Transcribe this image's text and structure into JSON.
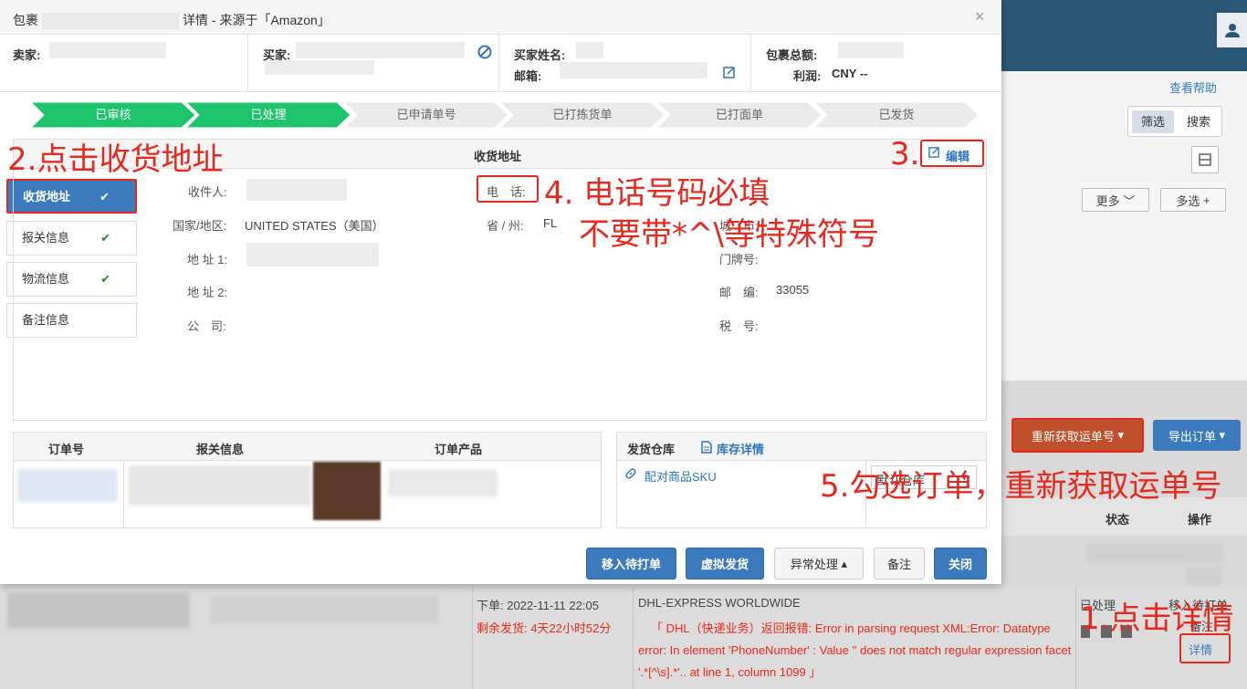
{
  "modal": {
    "title_prefix": "包裹",
    "title_suffix": "详情 - 来源于「Amazon」",
    "close": "×",
    "info": {
      "seller_label": "卖家:",
      "buyer_label": "买家:",
      "buyer_name_label": "买家姓名:",
      "email_label": "邮箱:",
      "total_label": "包裹总额:",
      "profit_label": "利润:",
      "profit_value": "CNY --"
    },
    "steps": [
      "已审核",
      "已处理",
      "已申请单号",
      "已打拣货单",
      "已打面单",
      "已发货"
    ],
    "nav": [
      {
        "label": "收货地址",
        "done": true,
        "active": true
      },
      {
        "label": "报关信息",
        "done": true,
        "active": false
      },
      {
        "label": "物流信息",
        "done": true,
        "active": false
      },
      {
        "label": "备注信息",
        "done": false,
        "active": false
      }
    ],
    "address": {
      "title": "收货地址",
      "edit": "编辑",
      "recipient_label": "收件人:",
      "country_label": "国家/地区:",
      "country_value": "UNITED STATES（美国）",
      "addr1_label": "地 址 1:",
      "addr2_label": "地 址 2:",
      "company_label": "公　司:",
      "phone_label": "电　话:",
      "state_label": "省 / 州:",
      "state_value": "FL",
      "city_label": "城　市:",
      "door_label": "门牌号:",
      "zip_label": "邮　编:",
      "zip_value": "33055",
      "tax_label": "税　号:"
    },
    "orders": {
      "col_order": "订单号",
      "col_customs": "报关信息",
      "col_product": "订单产品"
    },
    "warehouse": {
      "title": "发货仓库",
      "stock_link": "库存详情",
      "match_sku": "配对商品SKU",
      "default_wh": "默认仓库"
    },
    "buttons": {
      "move_to_print": "移入待打单",
      "virtual_ship": "虚拟发货",
      "exception": "异常处理",
      "remark": "备注",
      "close": "关闭"
    }
  },
  "background": {
    "help": "查看帮助",
    "filter": "筛选",
    "search": "搜索",
    "more": "更多",
    "multi": "多选",
    "refetch": "重新获取运单号",
    "export": "导出订单",
    "col_status": "状态",
    "col_action": "操作",
    "order_time": "下单:  2022-11-11 22:05",
    "remaining": "剩余发货:  4天22小时52分",
    "carrier": "DHL-EXPRESS WORLDWIDE",
    "error_msg": "「 DHL（快递业务）返回报错: Error in parsing request XML:Error: Datatype error: In element 'PhoneNumber' : Value '' does not match regular expression facet '.*[^\\s].*'.. at line 1, column 1099 」",
    "status_processed": "已处理",
    "move_to_pending": "移入待打单",
    "remark": "备注",
    "details": "详情"
  },
  "annotations": {
    "a1": "1.点击详情",
    "a2": "2.点击收货地址",
    "a3": "3.",
    "a4_line1": "4. 电话号码必填",
    "a4_line2": "不要带*^\\等特殊符号",
    "a5": "5.勾选订单，重新获取运单号"
  },
  "colors": {
    "step_done": "#1dc46b",
    "step_todo": "#eaeaea",
    "primary": "#3b7bbd",
    "annotation": "#e8281c",
    "topbar": "#2b5777"
  }
}
